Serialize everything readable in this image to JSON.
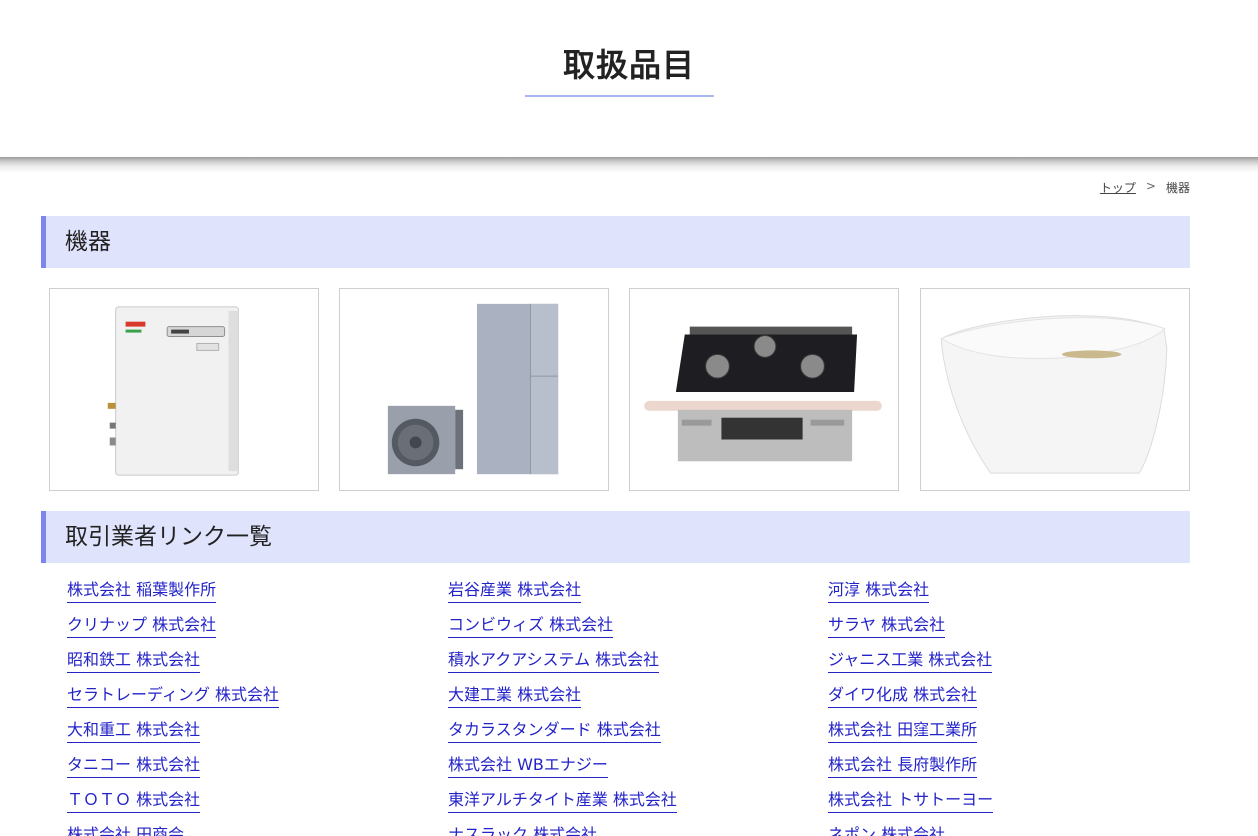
{
  "header": {
    "title": "取扱品目"
  },
  "breadcrumb": {
    "home": "トップ",
    "separator": ">",
    "current": "機器"
  },
  "sections": {
    "equipment": {
      "title": "機器"
    },
    "vendors": {
      "title": "取引業者リンク一覧"
    }
  },
  "products": [
    {
      "name": "water-heater"
    },
    {
      "name": "heat-pump-water-heater"
    },
    {
      "name": "gas-stove"
    },
    {
      "name": "toilet"
    }
  ],
  "vendors": [
    [
      "株式会社 稲葉製作所",
      "岩谷産業 株式会社",
      "河淳 株式会社"
    ],
    [
      "クリナップ 株式会社",
      "コンビウィズ 株式会社",
      "サラヤ 株式会社"
    ],
    [
      "昭和鉄工 株式会社",
      "積水アクアシステム 株式会社",
      "ジャニス工業 株式会社"
    ],
    [
      "セラトレーディング 株式会社",
      "大建工業 株式会社",
      "ダイワ化成 株式会社"
    ],
    [
      "大和重工 株式会社",
      "タカラスタンダード 株式会社",
      "株式会社 田窪工業所"
    ],
    [
      "タニコー 株式会社",
      "株式会社 WBエナジー",
      "株式会社 長府製作所"
    ],
    [
      "ＴＯＴＯ 株式会社",
      "東洋アルチタイト産業 株式会社",
      "株式会社 トサトーヨー"
    ],
    [
      "株式会社 田商会",
      "ナスラック 株式会社",
      "ネポン 株式会社"
    ]
  ]
}
